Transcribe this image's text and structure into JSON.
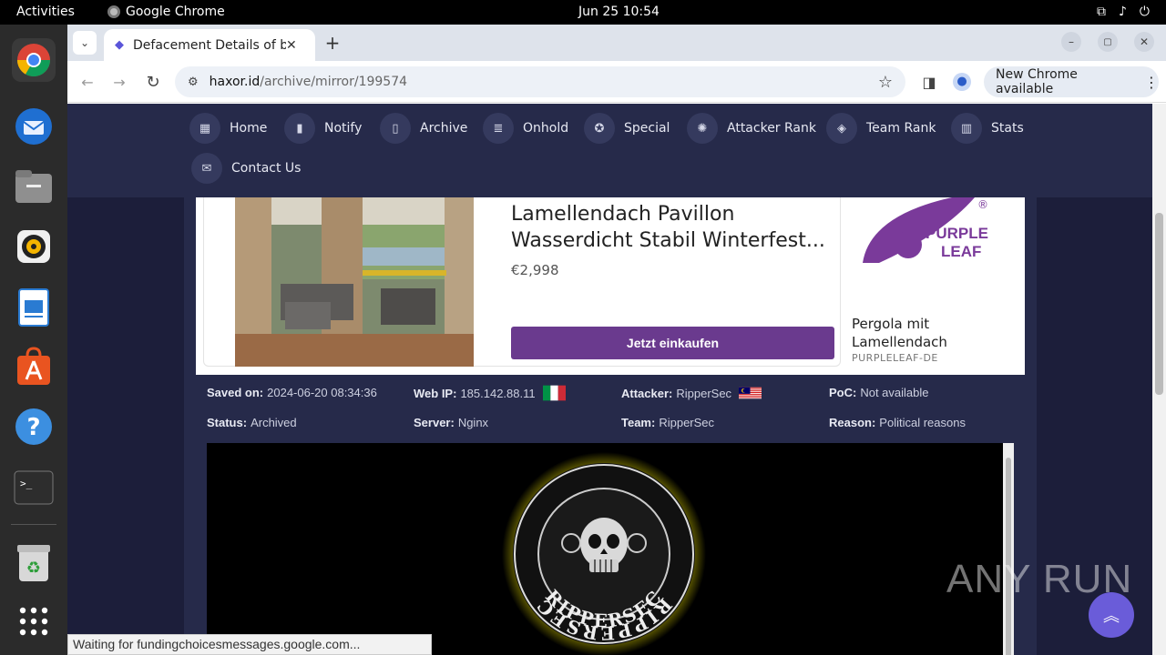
{
  "topbar": {
    "activities": "Activities",
    "app_name": "Google Chrome",
    "datetime": "Jun 25  10:54"
  },
  "dock": {
    "items": [
      "chrome-icon",
      "thunderbird-icon",
      "files-icon",
      "rhythmbox-icon",
      "writer-icon",
      "app-center-icon",
      "help-icon",
      "terminal-icon",
      "trash-icon",
      "app-grid-icon"
    ]
  },
  "browser": {
    "tab_title": "Defacement Details of b",
    "url_domain": "haxor.id",
    "url_path": "/archive/mirror/199574",
    "new_chrome": "New Chrome available",
    "status": "Waiting for fundingchoicesmessages.google.com..."
  },
  "nav": {
    "items": [
      {
        "label": "Home"
      },
      {
        "label": "Notify"
      },
      {
        "label": "Archive"
      },
      {
        "label": "Onhold"
      },
      {
        "label": "Special"
      },
      {
        "label": "Attacker Rank"
      },
      {
        "label": "Team Rank"
      },
      {
        "label": "Stats"
      },
      {
        "label": "Contact Us"
      }
    ]
  },
  "ad": {
    "product_title": "Lamellendach Pavillon Wasserdicht Stabil Winterfest...",
    "price": "€2,998",
    "cta": "Jetzt einkaufen",
    "brand_line1": "PURPLE",
    "brand_line2": "LEAF",
    "brand_mark": "®",
    "caption": "Pergola mit Lamellendach",
    "source": "PURPLELEAF-DE"
  },
  "details": {
    "saved_on_label": "Saved on:",
    "saved_on": "2024-06-20 08:34:36",
    "web_ip_label": "Web IP:",
    "web_ip": "185.142.88.11",
    "attacker_label": "Attacker:",
    "attacker": "RipperSec",
    "poc_label": "PoC:",
    "poc": "Not available",
    "status_label": "Status:",
    "status": "Archived",
    "server_label": "Server:",
    "server": "Nginx",
    "team_label": "Team:",
    "team": "RipperSec",
    "reason_label": "Reason:",
    "reason": "Political reasons"
  },
  "mirror": {
    "logo_top": "RIPPERSEC",
    "logo_bottom": "RIPPERSEC"
  },
  "watermark": "ANY RUN",
  "colors": {
    "nav_bg": "#262a4a",
    "cta": "#6a3a8e",
    "accent": "#6a5cd9"
  }
}
